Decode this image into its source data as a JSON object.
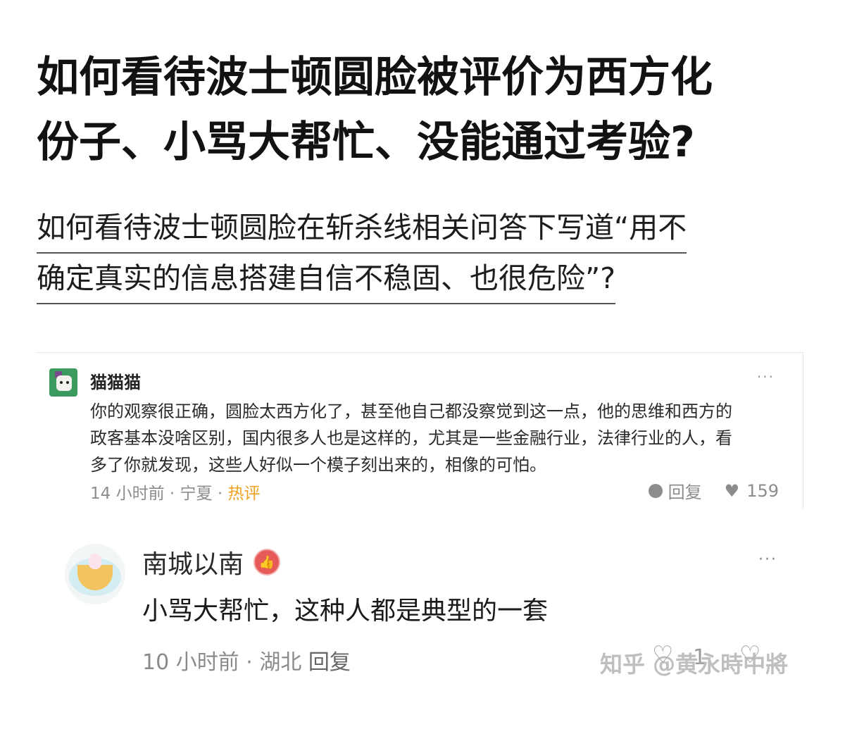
{
  "question": {
    "title_lines": [
      "如何看待波士顿圆脸被评价为西方化",
      "份子、小骂大帮忙、没能通过考验?"
    ],
    "link_lines": [
      "如何看待波士顿圆脸在斩杀线相关问答下写道“用不",
      "确定真实的信息搭建自信不稳固、也很危险”?"
    ]
  },
  "comment1": {
    "author": "猫猫猫",
    "more": "···",
    "text_lines": [
      "你的观察很正确，圆脸太西方化了，甚至他自己都没察觉到这一点，他的思维和西方的",
      "政客基本没啥区别，国内很多人也是这样的，尤其是一些金融行业，法律行业的人，看",
      "多了你就发现，这些人好似一个模子刻出来的，相像的可怕。"
    ],
    "time": "14 小时前",
    "sep": "·",
    "location": "宁夏",
    "hot_label": "热评",
    "reply_label": "回复",
    "likes": "159",
    "icons": [
      "reply-icon",
      "heart-icon"
    ]
  },
  "comment2": {
    "author": "南城以南",
    "badge_icon": "thumb-up-icon",
    "more": "···",
    "text": "小骂大帮忙，这种人都是典型的一套",
    "time": "10 小时前",
    "sep": "·",
    "location": "湖北",
    "reply_label": "回复",
    "likes": "1",
    "icons": [
      "heart-icon"
    ]
  },
  "watermark": "知乎 @黄永時中將",
  "colors": {
    "hot": "#f0a020",
    "meta": "#8c8c8c",
    "badge": "#e75a5a"
  }
}
